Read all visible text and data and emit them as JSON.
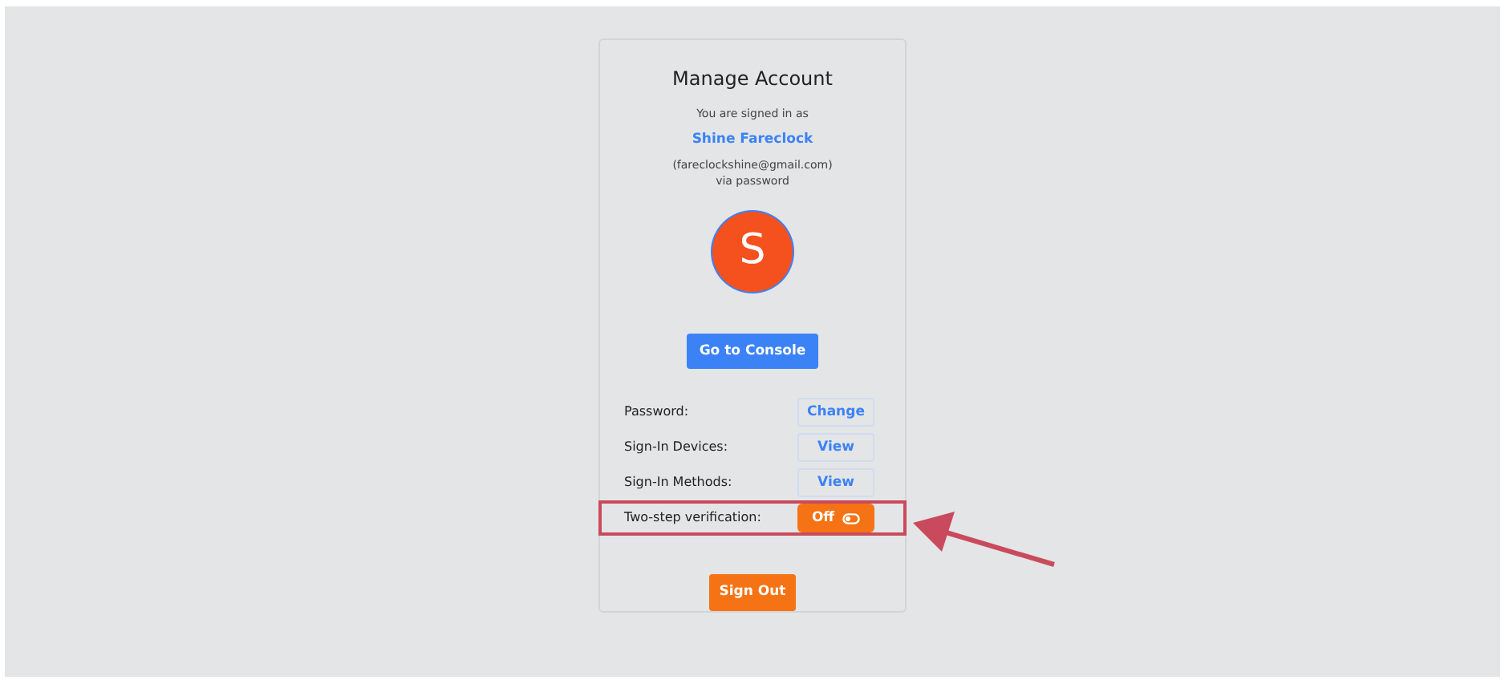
{
  "card": {
    "title": "Manage Account",
    "signed_in_label": "You are signed in as",
    "user_name": "Shine Fareclock",
    "email": "(fareclockshine@gmail.com)",
    "method": "via password",
    "avatar_letter": "S"
  },
  "console_button": "Go to Console",
  "settings": [
    {
      "label": "Password:",
      "kind": "button",
      "action": "Change",
      "highlighted": false
    },
    {
      "label": "Sign-In Devices:",
      "kind": "button",
      "action": "View",
      "highlighted": false
    },
    {
      "label": "Sign-In Methods:",
      "kind": "button",
      "action": "View",
      "highlighted": false
    },
    {
      "label": "Two-step verification:",
      "kind": "toggle",
      "action": "Off",
      "on": false,
      "highlighted": true
    }
  ],
  "sign_out_button": "Sign Out"
}
